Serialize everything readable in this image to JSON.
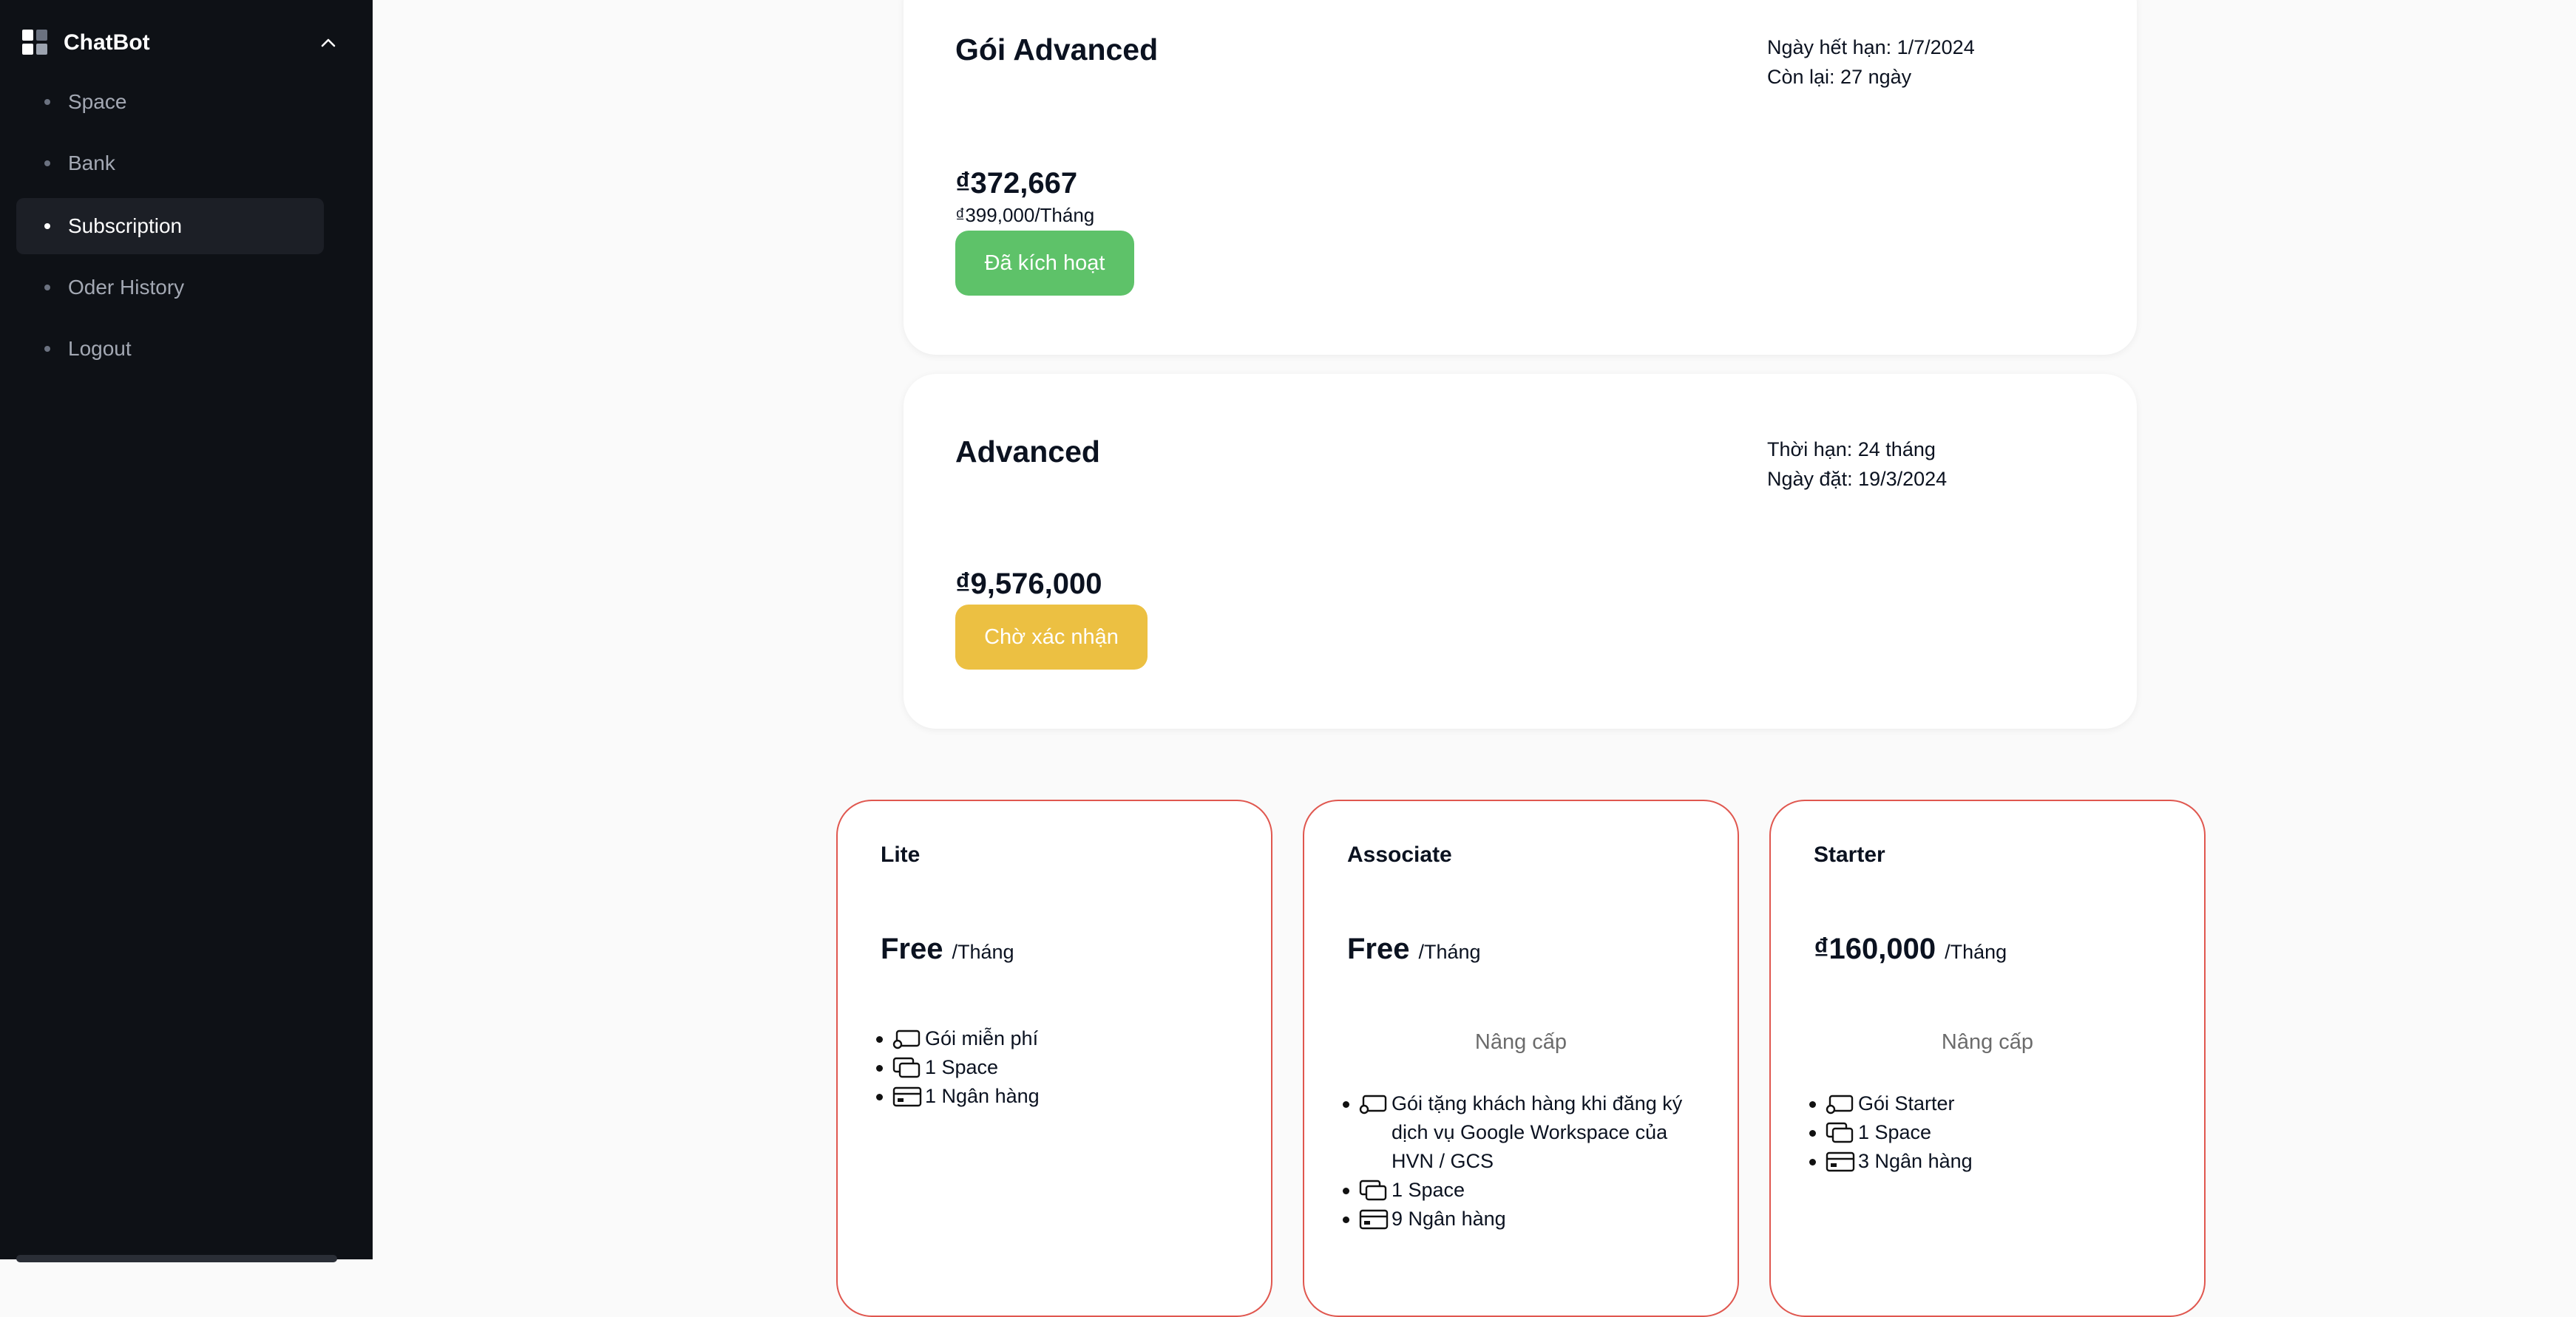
{
  "sidebar": {
    "brand": "ChatBot",
    "items": [
      {
        "label": "Space"
      },
      {
        "label": "Bank"
      },
      {
        "label": "Subscription"
      },
      {
        "label": "Oder History"
      },
      {
        "label": "Logout"
      }
    ]
  },
  "current": {
    "title": "Gói Advanced",
    "expiry": "Ngày hết hạn: 1/7/2024",
    "remaining": "Còn lại: 27 ngày",
    "price": "₫372,667",
    "monthly": "₫399,000/Tháng",
    "status": "Đã kích hoạt",
    "status_color": "#5ec269"
  },
  "order": {
    "title": "Advanced",
    "duration": "Thời hạn: 24 tháng",
    "order_date": "Ngày đặt: 19/3/2024",
    "price": "₫9,576,000",
    "status": "Chờ xác nhận",
    "status_color": "#ecc042"
  },
  "plans": [
    {
      "name": "Lite",
      "price": "Free",
      "per": "/Tháng",
      "upgrade": "",
      "features": [
        {
          "icon": "subscription-icon",
          "text": "Gói miễn phí"
        },
        {
          "icon": "space-icon",
          "text": "1 Space"
        },
        {
          "icon": "bank-card-icon",
          "text": "1 Ngân hàng"
        }
      ]
    },
    {
      "name": "Associate",
      "price": "Free",
      "per": "/Tháng",
      "upgrade": "Nâng cấp",
      "features": [
        {
          "icon": "subscription-icon",
          "text": "Gói tặng khách hàng khi đăng ký dịch vụ Google Workspace của HVN / GCS"
        },
        {
          "icon": "space-icon",
          "text": "1 Space"
        },
        {
          "icon": "bank-card-icon",
          "text": "9 Ngân hàng"
        }
      ]
    },
    {
      "name": "Starter",
      "price": "₫160,000",
      "per": "/Tháng",
      "upgrade": "Nâng cấp",
      "features": [
        {
          "icon": "subscription-icon",
          "text": "Gói Starter"
        },
        {
          "icon": "space-icon",
          "text": "1 Space"
        },
        {
          "icon": "bank-card-icon",
          "text": "3 Ngân hàng"
        }
      ]
    }
  ],
  "colors": {
    "sidebar_bg": "#0e1116",
    "plan_border": "#e0574f",
    "activated": "#5ec269",
    "pending": "#ecc042"
  }
}
